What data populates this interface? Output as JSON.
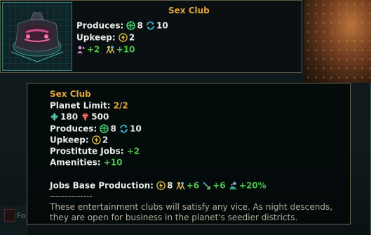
{
  "building": {
    "name": "Sex Club"
  },
  "summary": {
    "produces_label": "Produces:",
    "produces_trade": "8",
    "produces_amenities": "10",
    "upkeep_label": "Upkeep:",
    "upkeep_energy": "2",
    "jobs_line_a": "+2",
    "jobs_line_b": "+10"
  },
  "tooltip": {
    "title": "Sex Club",
    "planet_limit_label": "Planet Limit:",
    "planet_limit_value": "2/2",
    "cost_minerals": "180",
    "cost_rare": "500",
    "produces_label": "Produces:",
    "produces_trade": "8",
    "produces_amenities": "10",
    "upkeep_label": "Upkeep:",
    "upkeep_energy": "2",
    "prostitute_label": "Prostitute Jobs:",
    "prostitute_value": "+2",
    "amenities_label": "Amenities:",
    "amenities_value": "+10",
    "jobs_base_label": "Jobs Base Production:",
    "jbp_energy": "8",
    "jbp_a": "+6",
    "jbp_b": "+6",
    "jbp_c": "+20%",
    "separator": "--------------",
    "description": "These entertainment clubs will satisfy any vice. As night descends, they are open for business in the planet's seedier districts."
  },
  "background": {
    "strip_text": "Fo"
  },
  "icons": [
    "building-portrait",
    "trade-icon",
    "amenities-icon",
    "energy-icon",
    "pop-icon",
    "job-icon",
    "mineral-icon",
    "rare-crystal-icon",
    "unity-icon",
    "ship-icon"
  ],
  "colors": {
    "accent_gold": "#e2a33b",
    "positive_green": "#4fc24e",
    "border": "#6a6550",
    "teal": "#2f7d7a"
  }
}
